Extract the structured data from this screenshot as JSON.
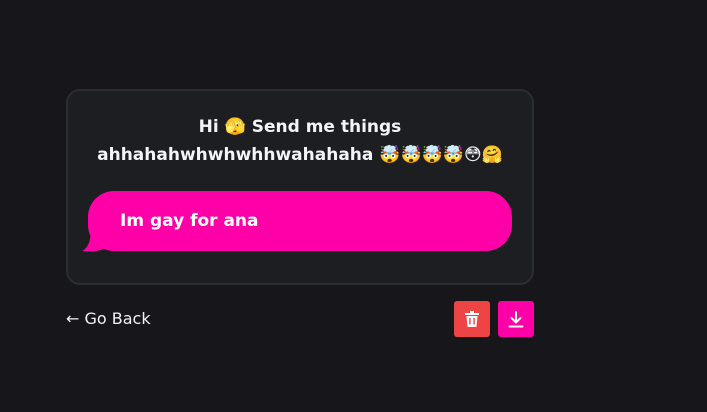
{
  "card": {
    "prompt": "Hi 🫣 Send me things\nahhahahwhwhwhhwahahaha 🤯🤯🤯🤯😳🤗"
  },
  "message": {
    "text": "Im gay for ana"
  },
  "footer": {
    "back_label": "← Go Back"
  },
  "actions": {
    "delete_icon": "trash-icon",
    "download_icon": "download-icon"
  },
  "colors": {
    "background": "#17171b",
    "card": "#1d1e22",
    "card_border": "#2c2d32",
    "bubble": "#ff00a8",
    "delete_button": "#ef4444",
    "download_button": "#ff00a8"
  }
}
